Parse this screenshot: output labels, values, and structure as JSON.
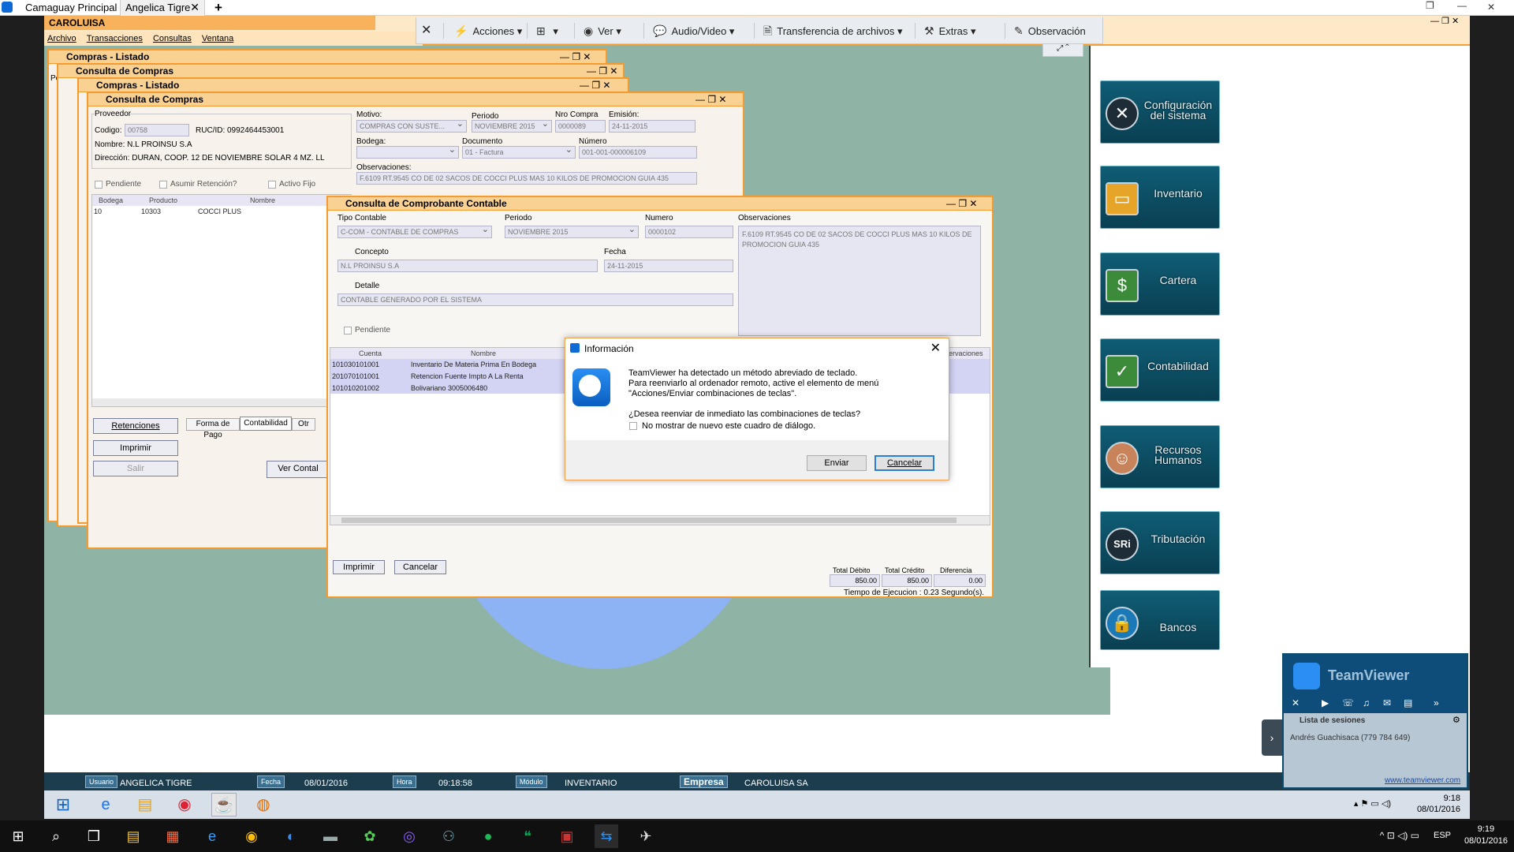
{
  "tv_tabs": [
    {
      "label": "Camaguay Principal"
    },
    {
      "label": "Angelica Tigre"
    }
  ],
  "tv_tab_add": "+",
  "app": {
    "title": "CAROLUISA",
    "menu": [
      "Archivo",
      "Transacciones",
      "Consultas",
      "Ventana"
    ]
  },
  "tv_toolbar": {
    "close": "✕",
    "actions": "Acciones",
    "view": "Ver",
    "audio": "Audio/Video",
    "files": "Transferencia de archivos",
    "extras": "Extras",
    "observe": "Observación"
  },
  "win_listado1": {
    "title": "Compras - Listado"
  },
  "win_consulta1": {
    "title": "Consulta de Compras"
  },
  "win_listado2": {
    "title": "Compras - Listado"
  },
  "win_consulta2": {
    "title": "Consulta de Compras",
    "proveedor_legend": "Proveedor",
    "codigo_label": "Codigo:",
    "codigo_value": "00758",
    "ruc_label": "RUC/ID: 0992464453001",
    "nombre_label": "Nombre: N.L PROINSU S.A",
    "direccion_label": "Dirección: DURAN, COOP. 12 DE NOVIEMBRE SOLAR 4 MZ. LL",
    "motivo_label": "Motivo:",
    "motivo_value": "COMPRAS CON SUSTE...",
    "periodo_label": "Periodo",
    "periodo_value": "NOVIEMBRE 2015",
    "nro_label": "Nro Compra",
    "nro_value": "0000089",
    "emision_label": "Emisión:",
    "emision_value": "24-11-2015",
    "bodega_label": "Bodega:",
    "documento_label": "Documento",
    "documento_value": "01 - Factura",
    "numero_label": "Número",
    "numero_value": "001-001-000006109",
    "obs_label": "Observaciones:",
    "obs_value": "F.6109 RT.9545 CO DE 02 SACOS DE COCCI PLUS MAS 10 KILOS DE PROMOCION GUIA 435",
    "pendiente": "Pendiente",
    "asumir": "Asumir Retención?",
    "activo": "Activo Fijo",
    "grid_headers": [
      "Bodega",
      "Producto",
      "Nombre"
    ],
    "grid_row": [
      "10",
      "10303",
      "COCCI PLUS"
    ],
    "btn_retenciones": "Retenciones",
    "btn_imprimir": "Imprimir",
    "btn_salir": "Salir",
    "tabs": [
      "Forma de Pago",
      "Contabilidad",
      "Otr"
    ],
    "btn_ver": "Ver Contal"
  },
  "win_contable": {
    "title": "Consulta de Comprobante Contable",
    "tipo_label": "Tipo Contable",
    "tipo_value": "C-COM - CONTABLE DE COMPRAS",
    "periodo_label": "Periodo",
    "periodo_value": "NOVIEMBRE 2015",
    "numero_label": "Numero",
    "numero_value": "0000102",
    "obs_label": "Observaciones",
    "obs_value": "F.6109 RT.9545 CO DE 02 SACOS DE COCCI PLUS MAS 10 KILOS DE PROMOCION GUIA 435",
    "concepto_label": "Concepto",
    "concepto_value": "N.L PROINSU S.A",
    "fecha_label": "Fecha",
    "fecha_value": "24-11-2015",
    "detalle_label": "Detalle",
    "detalle_value": "CONTABLE GENERADO POR EL SISTEMA",
    "pendiente": "Pendiente",
    "grid_headers": [
      "Cuenta",
      "Nombre",
      "ervaciones"
    ],
    "rows": [
      {
        "cuenta": "101030101001",
        "nombre": "Inventario De Materia Prima En Bodega"
      },
      {
        "cuenta": "201070101001",
        "nombre": "Retencion Fuente Impto A La Renta"
      },
      {
        "cuenta": "101010201002",
        "nombre": "Bolivariano 3005006480"
      }
    ],
    "btn_imprimir": "Imprimir",
    "btn_cancelar": "Cancelar",
    "total_debito_label": "Total Débito",
    "total_debito": "850.00",
    "total_credito_label": "Total Crédito",
    "total_credito": "850.00",
    "diferencia_label": "Diferencia",
    "diferencia": "0.00",
    "tiempo": "Tiempo de Ejecucion : 0.23 Segundo(s)."
  },
  "dialog": {
    "title": "Información",
    "line1": "TeamViewer ha detectado un método abreviado de teclado.",
    "line2": "Para reenviarlo al ordenador remoto, active el elemento de menú",
    "line3": "\"Acciones/Enviar combinaciones de teclas\".",
    "question": "¿Desea reenviar de inmediato las combinaciones de teclas?",
    "checkbox": "No mostrar de nuevo este cuadro de diálogo.",
    "btn_send": "Enviar",
    "btn_cancel": "Cancelar"
  },
  "modules": [
    {
      "label": "Configuración del sistema",
      "icon": "wrench-icon"
    },
    {
      "label": "Inventario",
      "icon": "folder-icon"
    },
    {
      "label": "Cartera",
      "icon": "money-icon"
    },
    {
      "label": "Contabilidad",
      "icon": "ledger-icon"
    },
    {
      "label": "Recursos Humanos",
      "icon": "people-icon"
    },
    {
      "label": "Tributación",
      "icon": "sri-icon"
    },
    {
      "label": "Bancos",
      "icon": "lock-icon"
    }
  ],
  "status": {
    "usuario_tag": "Usuario",
    "usuario": "ANGELICA TIGRE",
    "fecha_tag": "Fecha",
    "fecha": "08/01/2016",
    "hora_tag": "Hora",
    "hora": "09:18:58",
    "modulo_tag": "Módulo",
    "modulo": "INVENTARIO",
    "empresa_tag": "Empresa",
    "empresa": "CAROLUISA SA"
  },
  "tv_panel": {
    "brand": "TeamViewer",
    "sessions_label": "Lista de sesiones",
    "session": "Andrés Guachisaca (779 784 649)",
    "link": "www.teamviewer.com"
  },
  "remote_clock": {
    "time": "9:18",
    "date": "08/01/2016"
  },
  "host_clock": {
    "time": "9:19",
    "date": "08/01/2016",
    "lang": "ESP"
  }
}
